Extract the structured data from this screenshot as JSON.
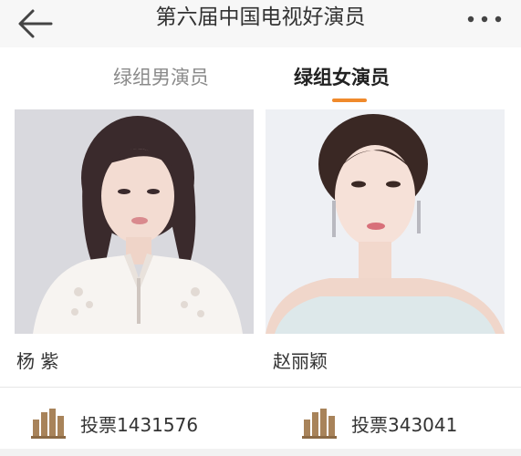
{
  "header": {
    "title": "第六届中国电视好演员",
    "back_icon": "back-arrow-icon",
    "more_icon": "more-dots-icon"
  },
  "tabs": [
    {
      "label": "绿组男演员",
      "active": false
    },
    {
      "label": "绿组女演员",
      "active": true
    }
  ],
  "accent_color": "#f08a2c",
  "cards": [
    {
      "name": "杨  紫",
      "vote_label": "投票1431576",
      "vote_icon": "bar-chart-icon"
    },
    {
      "name": "赵丽颖",
      "vote_label": "投票343041",
      "vote_icon": "bar-chart-icon"
    }
  ]
}
